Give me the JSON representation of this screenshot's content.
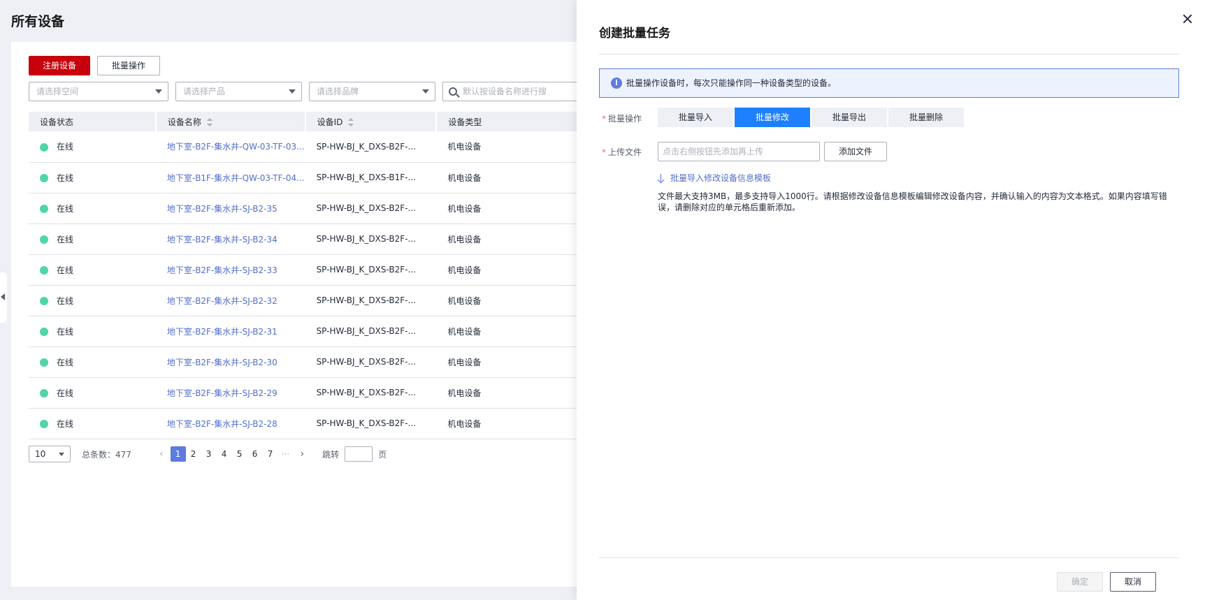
{
  "page": {
    "title": "所有设备"
  },
  "toolbar": {
    "register_label": "注册设备",
    "batch_label": "批量操作"
  },
  "filters": {
    "space_placeholder": "请选择空间",
    "product_placeholder": "请选择产品",
    "brand_placeholder": "请选择品牌",
    "search_placeholder": "默认按设备名称进行搜"
  },
  "table": {
    "headers": [
      "设备状态",
      "设备名称",
      "设备ID",
      "设备类型"
    ],
    "rows": [
      {
        "status": "在线",
        "name": "地下室-B2F-集水井-QW-03-TF-03...",
        "id": "SP-HW-BJ_K_DXS-B2F-...",
        "type": "机电设备"
      },
      {
        "status": "在线",
        "name": "地下室-B1F-集水井-QW-03-TF-04...",
        "id": "SP-HW-BJ_K_DXS-B1F-...",
        "type": "机电设备"
      },
      {
        "status": "在线",
        "name": "地下室-B2F-集水井-SJ-B2-35",
        "id": "SP-HW-BJ_K_DXS-B2F-...",
        "type": "机电设备"
      },
      {
        "status": "在线",
        "name": "地下室-B2F-集水井-SJ-B2-34",
        "id": "SP-HW-BJ_K_DXS-B2F-...",
        "type": "机电设备"
      },
      {
        "status": "在线",
        "name": "地下室-B2F-集水井-SJ-B2-33",
        "id": "SP-HW-BJ_K_DXS-B2F-...",
        "type": "机电设备"
      },
      {
        "status": "在线",
        "name": "地下室-B2F-集水井-SJ-B2-32",
        "id": "SP-HW-BJ_K_DXS-B2F-...",
        "type": "机电设备"
      },
      {
        "status": "在线",
        "name": "地下室-B2F-集水井-SJ-B2-31",
        "id": "SP-HW-BJ_K_DXS-B2F-...",
        "type": "机电设备"
      },
      {
        "status": "在线",
        "name": "地下室-B2F-集水井-SJ-B2-30",
        "id": "SP-HW-BJ_K_DXS-B2F-...",
        "type": "机电设备"
      },
      {
        "status": "在线",
        "name": "地下室-B2F-集水井-SJ-B2-29",
        "id": "SP-HW-BJ_K_DXS-B2F-...",
        "type": "机电设备"
      },
      {
        "status": "在线",
        "name": "地下室-B2F-集水井-SJ-B2-28",
        "id": "SP-HW-BJ_K_DXS-B2F-...",
        "type": "机电设备"
      }
    ]
  },
  "pager": {
    "page_size": "10",
    "total": "总条数：477",
    "pages": [
      "1",
      "2",
      "3",
      "4",
      "5",
      "6",
      "7",
      "···"
    ],
    "prev": "‹",
    "next": "›",
    "jump_label": "跳转",
    "page_suffix": "页"
  },
  "drawer": {
    "title": "创建批量任务",
    "info": "批量操作设备时，每次只能操作同一种设备类型的设备。",
    "op_label": "批量操作",
    "segments": [
      "批量导入",
      "批量修改",
      "批量导出",
      "批量删除"
    ],
    "upload_label": "上传文件",
    "upload_placeholder": "点击右侧按钮先添加再上传",
    "add_file": "添加文件",
    "download_link": "批量导入修改设备信息模板",
    "hint": "文件最大支持3MB，最多支持导入1000行。请根据修改设备信息模板编辑修改设备内容，并确认输入的内容为文本格式。如果内容填写错误，请删除对应的单元格后重新添加。",
    "confirm": "确定",
    "cancel": "取消"
  },
  "colors": {
    "brand": "#c7000b",
    "accent": "#1e7fff",
    "online": "#50d4ab",
    "link": "#526ecc"
  }
}
